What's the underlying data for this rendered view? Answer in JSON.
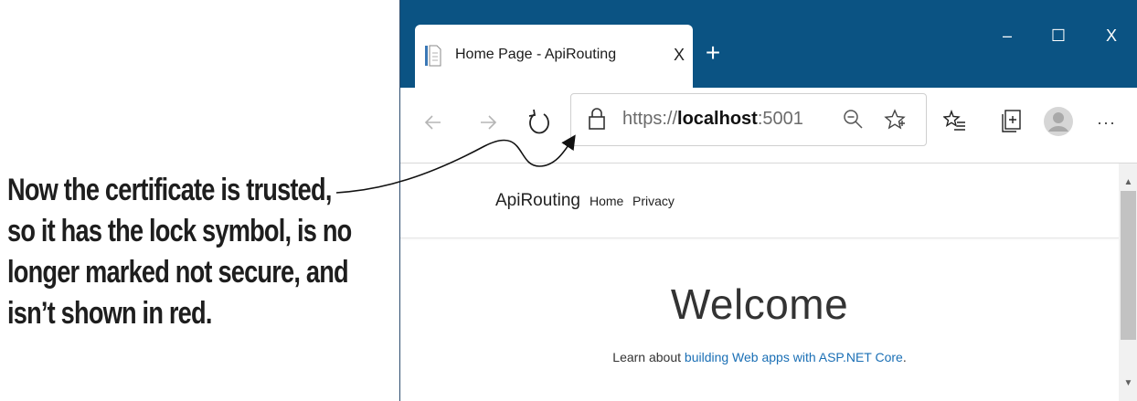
{
  "callout": {
    "lines": [
      "Now the certificate is trusted,",
      "so it has the lock symbol, is no",
      "longer marked not secure, and",
      "isn’t shown in red."
    ]
  },
  "window": {
    "controls": {
      "minimize": "–",
      "maximize": "☐",
      "close": "X"
    }
  },
  "tab": {
    "title": "Home Page - ApiRouting",
    "close_glyph": "X",
    "new_tab_glyph": "+"
  },
  "toolbar": {
    "url_scheme": "https://",
    "url_host": "localhost",
    "url_port": ":5001",
    "more_glyph": "···"
  },
  "page": {
    "brand": "ApiRouting",
    "nav": {
      "home": "Home",
      "privacy": "Privacy"
    },
    "heading": "Welcome",
    "learn_prefix": "Learn about ",
    "learn_link": "building Web apps with ASP.NET Core",
    "learn_suffix": "."
  },
  "colors": {
    "titlebar": "#0b5383",
    "link": "#1a6fb5"
  },
  "icons": [
    "document-icon",
    "back-icon",
    "forward-icon",
    "refresh-icon",
    "lock-icon",
    "zoom-out-icon",
    "favorite-star-icon",
    "favorites-list-icon",
    "collections-icon",
    "profile-avatar-icon",
    "more-icon"
  ]
}
